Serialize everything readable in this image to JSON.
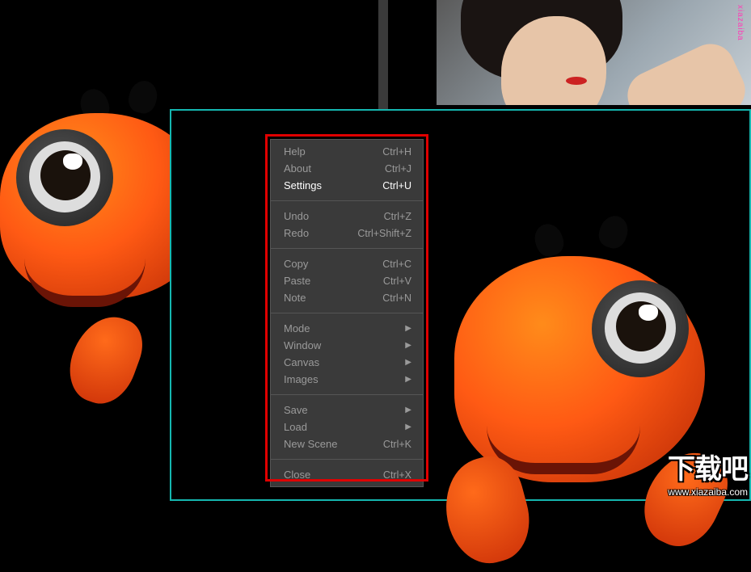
{
  "thumbnail": {
    "watermark": "xiazaiba"
  },
  "menu": {
    "groups": [
      [
        {
          "label": "Help",
          "shortcut": "Ctrl+H",
          "submenu": false,
          "state": ""
        },
        {
          "label": "About",
          "shortcut": "Ctrl+J",
          "submenu": false,
          "state": ""
        },
        {
          "label": "Settings",
          "shortcut": "Ctrl+U",
          "submenu": false,
          "state": "hover"
        }
      ],
      [
        {
          "label": "Undo",
          "shortcut": "Ctrl+Z",
          "submenu": false,
          "state": ""
        },
        {
          "label": "Redo",
          "shortcut": "Ctrl+Shift+Z",
          "submenu": false,
          "state": ""
        }
      ],
      [
        {
          "label": "Copy",
          "shortcut": "Ctrl+C",
          "submenu": false,
          "state": ""
        },
        {
          "label": "Paste",
          "shortcut": "Ctrl+V",
          "submenu": false,
          "state": ""
        },
        {
          "label": "Note",
          "shortcut": "Ctrl+N",
          "submenu": false,
          "state": ""
        }
      ],
      [
        {
          "label": "Mode",
          "shortcut": "",
          "submenu": true,
          "state": ""
        },
        {
          "label": "Window",
          "shortcut": "",
          "submenu": true,
          "state": ""
        },
        {
          "label": "Canvas",
          "shortcut": "",
          "submenu": true,
          "state": ""
        },
        {
          "label": "Images",
          "shortcut": "",
          "submenu": true,
          "state": ""
        }
      ],
      [
        {
          "label": "Save",
          "shortcut": "",
          "submenu": true,
          "state": ""
        },
        {
          "label": "Load",
          "shortcut": "",
          "submenu": true,
          "state": ""
        },
        {
          "label": "New Scene",
          "shortcut": "Ctrl+K",
          "submenu": false,
          "state": ""
        }
      ],
      [
        {
          "label": "Close",
          "shortcut": "Ctrl+X",
          "submenu": false,
          "state": ""
        }
      ]
    ]
  },
  "watermark": {
    "text": "下载吧",
    "url": "www.xiazaiba.com"
  }
}
